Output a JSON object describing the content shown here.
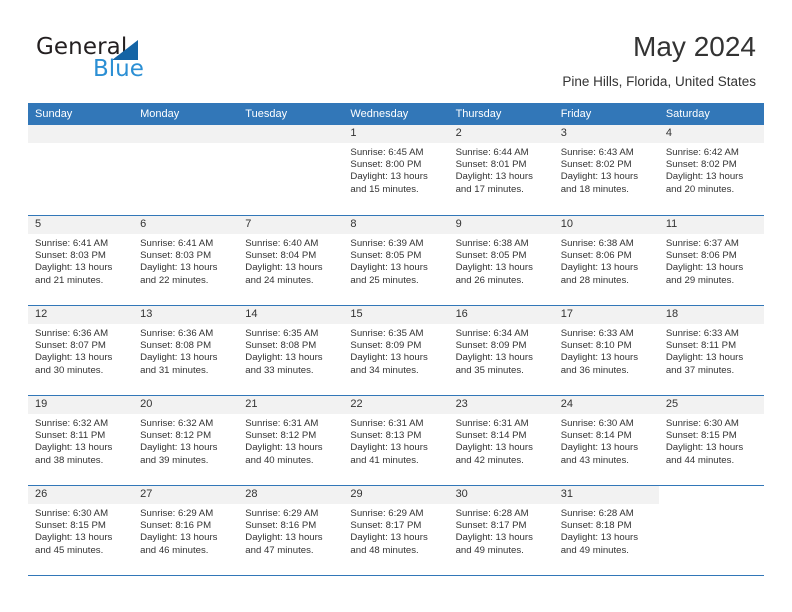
{
  "brand": {
    "name_part1": "General",
    "name_part2": "Blue",
    "triangle_color": "#1464a5",
    "blue_color": "#2b8fd4"
  },
  "header": {
    "month_title": "May 2024",
    "location": "Pine Hills, Florida, United States"
  },
  "theme": {
    "header_band": "#3277b8",
    "day_band": "#f2f2f2",
    "text": "#333333"
  },
  "weekdays": [
    "Sunday",
    "Monday",
    "Tuesday",
    "Wednesday",
    "Thursday",
    "Friday",
    "Saturday"
  ],
  "weeks": [
    [
      {
        "day": "",
        "lines": []
      },
      {
        "day": "",
        "lines": []
      },
      {
        "day": "",
        "lines": []
      },
      {
        "day": "1",
        "lines": [
          "Sunrise: 6:45 AM",
          "Sunset: 8:00 PM",
          "Daylight: 13 hours",
          "and 15 minutes."
        ]
      },
      {
        "day": "2",
        "lines": [
          "Sunrise: 6:44 AM",
          "Sunset: 8:01 PM",
          "Daylight: 13 hours",
          "and 17 minutes."
        ]
      },
      {
        "day": "3",
        "lines": [
          "Sunrise: 6:43 AM",
          "Sunset: 8:02 PM",
          "Daylight: 13 hours",
          "and 18 minutes."
        ]
      },
      {
        "day": "4",
        "lines": [
          "Sunrise: 6:42 AM",
          "Sunset: 8:02 PM",
          "Daylight: 13 hours",
          "and 20 minutes."
        ]
      }
    ],
    [
      {
        "day": "5",
        "lines": [
          "Sunrise: 6:41 AM",
          "Sunset: 8:03 PM",
          "Daylight: 13 hours",
          "and 21 minutes."
        ]
      },
      {
        "day": "6",
        "lines": [
          "Sunrise: 6:41 AM",
          "Sunset: 8:03 PM",
          "Daylight: 13 hours",
          "and 22 minutes."
        ]
      },
      {
        "day": "7",
        "lines": [
          "Sunrise: 6:40 AM",
          "Sunset: 8:04 PM",
          "Daylight: 13 hours",
          "and 24 minutes."
        ]
      },
      {
        "day": "8",
        "lines": [
          "Sunrise: 6:39 AM",
          "Sunset: 8:05 PM",
          "Daylight: 13 hours",
          "and 25 minutes."
        ]
      },
      {
        "day": "9",
        "lines": [
          "Sunrise: 6:38 AM",
          "Sunset: 8:05 PM",
          "Daylight: 13 hours",
          "and 26 minutes."
        ]
      },
      {
        "day": "10",
        "lines": [
          "Sunrise: 6:38 AM",
          "Sunset: 8:06 PM",
          "Daylight: 13 hours",
          "and 28 minutes."
        ]
      },
      {
        "day": "11",
        "lines": [
          "Sunrise: 6:37 AM",
          "Sunset: 8:06 PM",
          "Daylight: 13 hours",
          "and 29 minutes."
        ]
      }
    ],
    [
      {
        "day": "12",
        "lines": [
          "Sunrise: 6:36 AM",
          "Sunset: 8:07 PM",
          "Daylight: 13 hours",
          "and 30 minutes."
        ]
      },
      {
        "day": "13",
        "lines": [
          "Sunrise: 6:36 AM",
          "Sunset: 8:08 PM",
          "Daylight: 13 hours",
          "and 31 minutes."
        ]
      },
      {
        "day": "14",
        "lines": [
          "Sunrise: 6:35 AM",
          "Sunset: 8:08 PM",
          "Daylight: 13 hours",
          "and 33 minutes."
        ]
      },
      {
        "day": "15",
        "lines": [
          "Sunrise: 6:35 AM",
          "Sunset: 8:09 PM",
          "Daylight: 13 hours",
          "and 34 minutes."
        ]
      },
      {
        "day": "16",
        "lines": [
          "Sunrise: 6:34 AM",
          "Sunset: 8:09 PM",
          "Daylight: 13 hours",
          "and 35 minutes."
        ]
      },
      {
        "day": "17",
        "lines": [
          "Sunrise: 6:33 AM",
          "Sunset: 8:10 PM",
          "Daylight: 13 hours",
          "and 36 minutes."
        ]
      },
      {
        "day": "18",
        "lines": [
          "Sunrise: 6:33 AM",
          "Sunset: 8:11 PM",
          "Daylight: 13 hours",
          "and 37 minutes."
        ]
      }
    ],
    [
      {
        "day": "19",
        "lines": [
          "Sunrise: 6:32 AM",
          "Sunset: 8:11 PM",
          "Daylight: 13 hours",
          "and 38 minutes."
        ]
      },
      {
        "day": "20",
        "lines": [
          "Sunrise: 6:32 AM",
          "Sunset: 8:12 PM",
          "Daylight: 13 hours",
          "and 39 minutes."
        ]
      },
      {
        "day": "21",
        "lines": [
          "Sunrise: 6:31 AM",
          "Sunset: 8:12 PM",
          "Daylight: 13 hours",
          "and 40 minutes."
        ]
      },
      {
        "day": "22",
        "lines": [
          "Sunrise: 6:31 AM",
          "Sunset: 8:13 PM",
          "Daylight: 13 hours",
          "and 41 minutes."
        ]
      },
      {
        "day": "23",
        "lines": [
          "Sunrise: 6:31 AM",
          "Sunset: 8:14 PM",
          "Daylight: 13 hours",
          "and 42 minutes."
        ]
      },
      {
        "day": "24",
        "lines": [
          "Sunrise: 6:30 AM",
          "Sunset: 8:14 PM",
          "Daylight: 13 hours",
          "and 43 minutes."
        ]
      },
      {
        "day": "25",
        "lines": [
          "Sunrise: 6:30 AM",
          "Sunset: 8:15 PM",
          "Daylight: 13 hours",
          "and 44 minutes."
        ]
      }
    ],
    [
      {
        "day": "26",
        "lines": [
          "Sunrise: 6:30 AM",
          "Sunset: 8:15 PM",
          "Daylight: 13 hours",
          "and 45 minutes."
        ]
      },
      {
        "day": "27",
        "lines": [
          "Sunrise: 6:29 AM",
          "Sunset: 8:16 PM",
          "Daylight: 13 hours",
          "and 46 minutes."
        ]
      },
      {
        "day": "28",
        "lines": [
          "Sunrise: 6:29 AM",
          "Sunset: 8:16 PM",
          "Daylight: 13 hours",
          "and 47 minutes."
        ]
      },
      {
        "day": "29",
        "lines": [
          "Sunrise: 6:29 AM",
          "Sunset: 8:17 PM",
          "Daylight: 13 hours",
          "and 48 minutes."
        ]
      },
      {
        "day": "30",
        "lines": [
          "Sunrise: 6:28 AM",
          "Sunset: 8:17 PM",
          "Daylight: 13 hours",
          "and 49 minutes."
        ]
      },
      {
        "day": "31",
        "lines": [
          "Sunrise: 6:28 AM",
          "Sunset: 8:18 PM",
          "Daylight: 13 hours",
          "and 49 minutes."
        ]
      },
      {
        "day": "",
        "lines": []
      }
    ]
  ]
}
